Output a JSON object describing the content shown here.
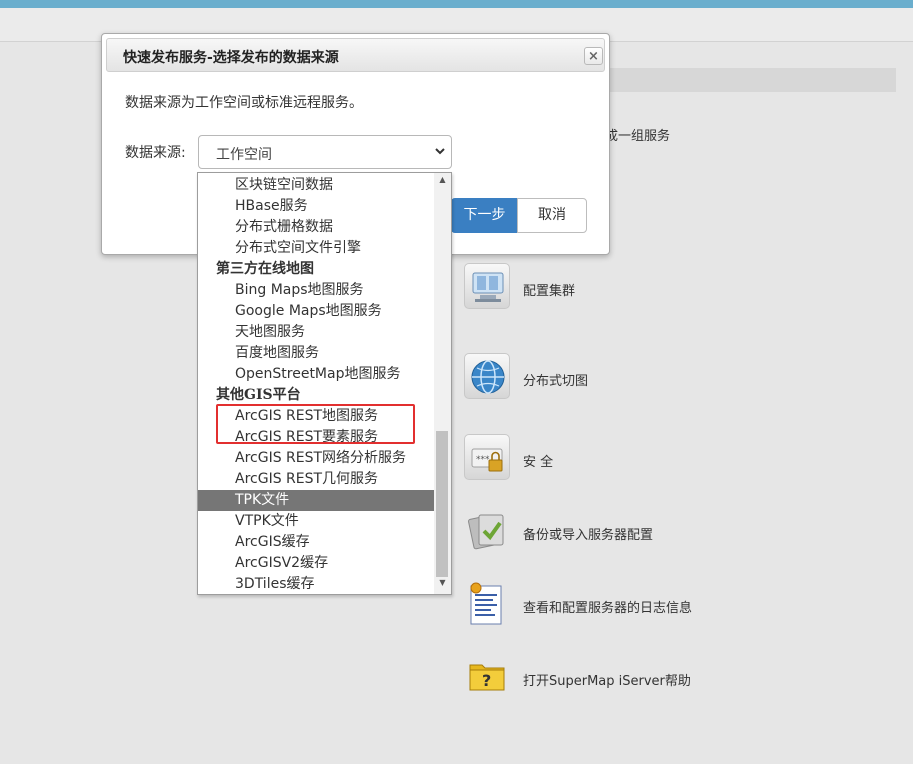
{
  "background": {
    "partial_text": "成一组服务",
    "items": [
      {
        "icon": "cluster-config-icon",
        "label": "配置集群"
      },
      {
        "icon": "globe-tile-icon",
        "label": "分布式切图"
      },
      {
        "icon": "lock-security-icon",
        "label": "安 全"
      },
      {
        "icon": "backup-import-icon",
        "label": "备份或导入服务器配置"
      },
      {
        "icon": "log-document-icon",
        "label": "查看和配置服务器的日志信息"
      },
      {
        "icon": "help-folder-icon",
        "label": "打开SuperMap iServer帮助"
      }
    ]
  },
  "dialog": {
    "title": "快速发布服务-选择发布的数据来源",
    "close_label": "×",
    "description": "数据来源为工作空间或标准远程服务。",
    "source_label": "数据来源:",
    "selected_value": "工作空间",
    "next_label": "下一步",
    "cancel_label": "取消"
  },
  "dropdown": {
    "options": [
      {
        "type": "option",
        "label": "区块链空间数据"
      },
      {
        "type": "option",
        "label": "HBase服务"
      },
      {
        "type": "option",
        "label": "分布式栅格数据"
      },
      {
        "type": "option",
        "label": "分布式空间文件引擎"
      },
      {
        "type": "group",
        "label": "第三方在线地图"
      },
      {
        "type": "option",
        "label": "Bing Maps地图服务"
      },
      {
        "type": "option",
        "label": "Google Maps地图服务"
      },
      {
        "type": "option",
        "label": "天地图服务"
      },
      {
        "type": "option",
        "label": "百度地图服务"
      },
      {
        "type": "option",
        "label": "OpenStreetMap地图服务"
      },
      {
        "type": "group",
        "label": "其他GIS平台"
      },
      {
        "type": "option",
        "label": "ArcGIS REST地图服务"
      },
      {
        "type": "option",
        "label": "ArcGIS REST要素服务"
      },
      {
        "type": "option",
        "label": "ArcGIS REST网络分析服务"
      },
      {
        "type": "option",
        "label": "ArcGIS REST几何服务"
      },
      {
        "type": "option",
        "label": "TPK文件",
        "selected": true
      },
      {
        "type": "option",
        "label": "VTPK文件"
      },
      {
        "type": "option",
        "label": "ArcGIS缓存"
      },
      {
        "type": "option",
        "label": "ArcGISV2缓存"
      },
      {
        "type": "option",
        "label": "3DTiles缓存"
      }
    ]
  },
  "colors": {
    "accent": "#3a7fc2",
    "selected_bg": "#767676",
    "highlight": "#e22f2f",
    "top_bar": "#6aaecd"
  }
}
